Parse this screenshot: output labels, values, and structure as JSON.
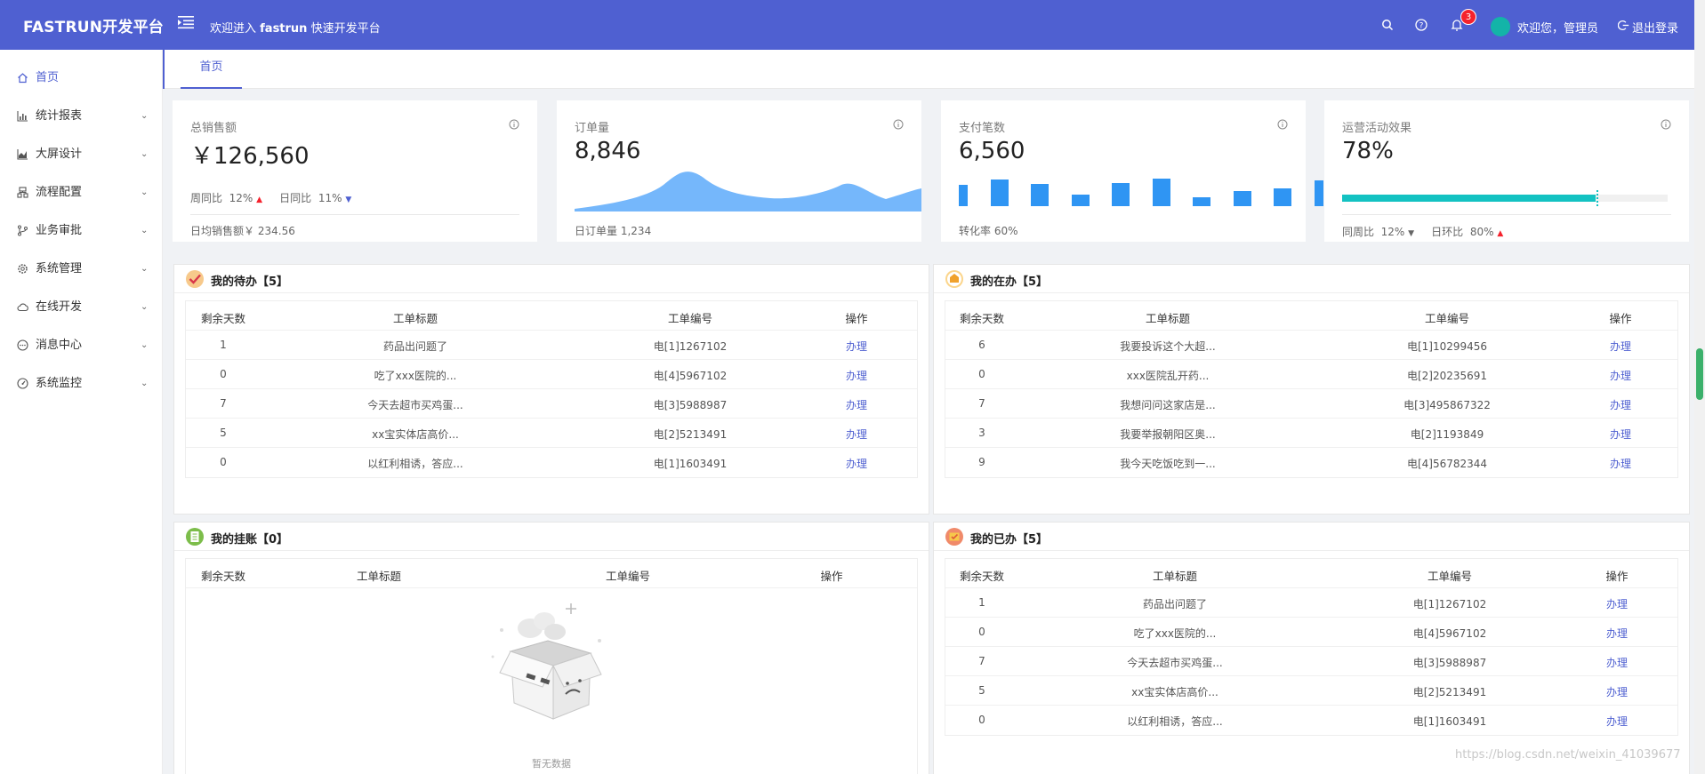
{
  "app": {
    "brand": "FASTRUN开发平台",
    "welcome_prefix": "欢迎进入 ",
    "welcome_bold": "fastrun",
    "welcome_suffix": " 快速开发平台",
    "notif_count": "3",
    "user_greeting": "欢迎您，管理员",
    "logout_label": "退出登录",
    "accent": "#4f60d1"
  },
  "sidebar": {
    "items": [
      {
        "label": "首页",
        "icon": "home-icon"
      },
      {
        "label": "统计报表",
        "icon": "bar-chart-icon"
      },
      {
        "label": "大屏设计",
        "icon": "area-chart-icon"
      },
      {
        "label": "流程配置",
        "icon": "flow-icon"
      },
      {
        "label": "业务审批",
        "icon": "branch-icon"
      },
      {
        "label": "系统管理",
        "icon": "gear-icon"
      },
      {
        "label": "在线开发",
        "icon": "cloud-icon"
      },
      {
        "label": "消息中心",
        "icon": "message-icon"
      },
      {
        "label": "系统监控",
        "icon": "dashboard-icon"
      }
    ]
  },
  "tabs": {
    "home": "首页"
  },
  "cards": {
    "sales": {
      "title": "总销售额",
      "value": "￥126,560",
      "wow_label": "周同比",
      "wow": "12%",
      "dod_label": "日同比",
      "dod": "11%",
      "foot_label": "日均销售额￥",
      "foot_value": "234.56"
    },
    "orders": {
      "title": "订单量",
      "value": "8,846",
      "foot_label": "日订单量",
      "foot_value": "1,234"
    },
    "payments": {
      "title": "支付笔数",
      "value": "6,560",
      "foot_label": "转化率",
      "foot_value": "60%"
    },
    "ops": {
      "title": "运营活动效果",
      "value": "78%",
      "progress": 0.78,
      "wow_label": "同周比",
      "wow": "12%",
      "dod_label": "日环比",
      "dod": "80%"
    }
  },
  "panels": {
    "todo": {
      "title": "我的待办【5】",
      "cols": [
        "剩余天数",
        "工单标题",
        "工单编号",
        "操作"
      ],
      "rows": [
        [
          "1",
          "药品出问题了",
          "电[1]1267102",
          "办理"
        ],
        [
          "0",
          "吃了xxx医院的...",
          "电[4]5967102",
          "办理"
        ],
        [
          "7",
          "今天去超市买鸡蛋...",
          "电[3]5988987",
          "办理"
        ],
        [
          "5",
          "xx宝实体店高价...",
          "电[2]5213491",
          "办理"
        ],
        [
          "0",
          "以红利相诱，答应...",
          "电[1]1603491",
          "办理"
        ]
      ]
    },
    "doing": {
      "title": "我的在办【5】",
      "cols": [
        "剩余天数",
        "工单标题",
        "工单编号",
        "操作"
      ],
      "rows": [
        [
          "6",
          "我要投诉这个大超...",
          "电[1]10299456",
          "办理"
        ],
        [
          "0",
          "xxx医院乱开药...",
          "电[2]20235691",
          "办理"
        ],
        [
          "7",
          "我想问问这家店是...",
          "电[3]495867322",
          "办理"
        ],
        [
          "3",
          "我要举报朝阳区奥...",
          "电[2]1193849",
          "办理"
        ],
        [
          "9",
          "我今天吃饭吃到一...",
          "电[4]56782344",
          "办理"
        ]
      ]
    },
    "pending": {
      "title": "我的挂账【0】",
      "cols": [
        "剩余天数",
        "工单标题",
        "工单编号",
        "操作"
      ],
      "empty": "暂无数据"
    },
    "done": {
      "title": "我的已办【5】",
      "cols": [
        "剩余天数",
        "工单标题",
        "工单编号",
        "操作"
      ],
      "rows": [
        [
          "1",
          "药品出问题了",
          "电[1]1267102",
          "办理"
        ],
        [
          "0",
          "吃了xxx医院的...",
          "电[4]5967102",
          "办理"
        ],
        [
          "7",
          "今天去超市买鸡蛋...",
          "电[3]5988987",
          "办理"
        ],
        [
          "5",
          "xx宝实体店高价...",
          "电[2]5213491",
          "办理"
        ],
        [
          "0",
          "以红利相诱，答应...",
          "电[1]1603491",
          "办理"
        ]
      ]
    }
  },
  "watermark": "https://blog.csdn.net/weixin_41039677"
}
